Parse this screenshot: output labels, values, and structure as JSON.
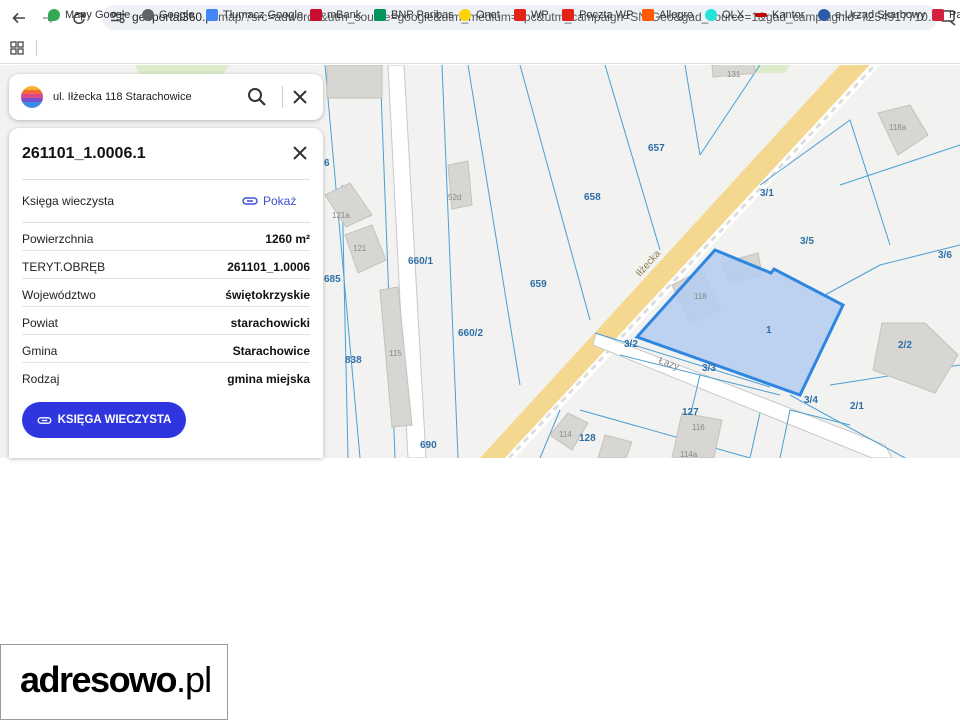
{
  "browser": {
    "url_domain": "geoportal360.pl",
    "url_rest": "/map/?src=adwords&utm_source=google&utm_medium=cpc&utm_campaign=SN-Geo&gad_source=1&gad_campaignid=7254917710...",
    "bookmarks": [
      {
        "label": "Mapy Google",
        "color": "#34a853"
      },
      {
        "label": "Google",
        "color": "#5f6368"
      },
      {
        "label": "Tłumacz Google",
        "color": "#4285f4"
      },
      {
        "label": "mBank",
        "color": "#c8102e"
      },
      {
        "label": "BNP Paribas",
        "color": "#00965e"
      },
      {
        "label": "Onet",
        "color": "#ffd200"
      },
      {
        "label": "WP",
        "color": "#e2231a"
      },
      {
        "label": "Poczta WP",
        "color": "#e2231a"
      },
      {
        "label": "Allegro",
        "color": "#ff5a00"
      },
      {
        "label": "OLX",
        "color": "#23e5db"
      },
      {
        "label": "Kantor",
        "color": "#c00000"
      },
      {
        "label": "e-Urząd Skarbowy",
        "color": "#2b5aa8"
      },
      {
        "label": "Pa",
        "color": "#d4213d"
      }
    ]
  },
  "search": {
    "address": "ul. Iłżecka 118 Starachowice"
  },
  "parcel": {
    "id": "261101_1.0006.1",
    "kw_label": "Księga wieczysta",
    "kw_link": "Pokaż",
    "rows": [
      {
        "key": "Powierzchnia",
        "value": "1260 m²"
      },
      {
        "key": "TERYT.OBRĘB",
        "value": "261101_1.0006"
      },
      {
        "key": "Województwo",
        "value": "świętokrzyskie"
      },
      {
        "key": "Powiat",
        "value": "starachowicki"
      },
      {
        "key": "Gmina",
        "value": "Starachowice"
      },
      {
        "key": "Rodzaj",
        "value": "gmina miejska"
      }
    ],
    "button_label": "KSIĘGA WIECZYSTA"
  },
  "map": {
    "street_label": "Iłżecka",
    "street_label_2": "Łazy",
    "parcel_labels": {
      "p657": "657",
      "p658": "658",
      "p659": "659",
      "p660_1": "660/1",
      "p660_2": "660/2",
      "p685": "685",
      "p838": "838",
      "p690": "690",
      "p1": "1",
      "p3_1": "3/1",
      "p3_2": "3/2",
      "p3_3": "3/3",
      "p3_4": "3/4",
      "p3_5": "3/5",
      "p3_6": "3/6",
      "p2_1": "2/1",
      "p2_2": "2/2",
      "p127": "127",
      "p128": "128",
      "p6": "6"
    },
    "building_labels": {
      "b131": "131",
      "b118a": "118a",
      "b52d": "52d",
      "b121a": "121a",
      "b121": "121",
      "b118": "118",
      "b115": "115",
      "b114": "114",
      "b116": "116",
      "b114a": "114a"
    },
    "colors": {
      "selected_fill": "#b3cdf0",
      "selected_stroke": "#2f86e0",
      "road": "#f5d88f",
      "parcel_line": "#4a9fd4"
    }
  },
  "brand": {
    "main": "adresowo",
    "suffix": ".pl"
  }
}
